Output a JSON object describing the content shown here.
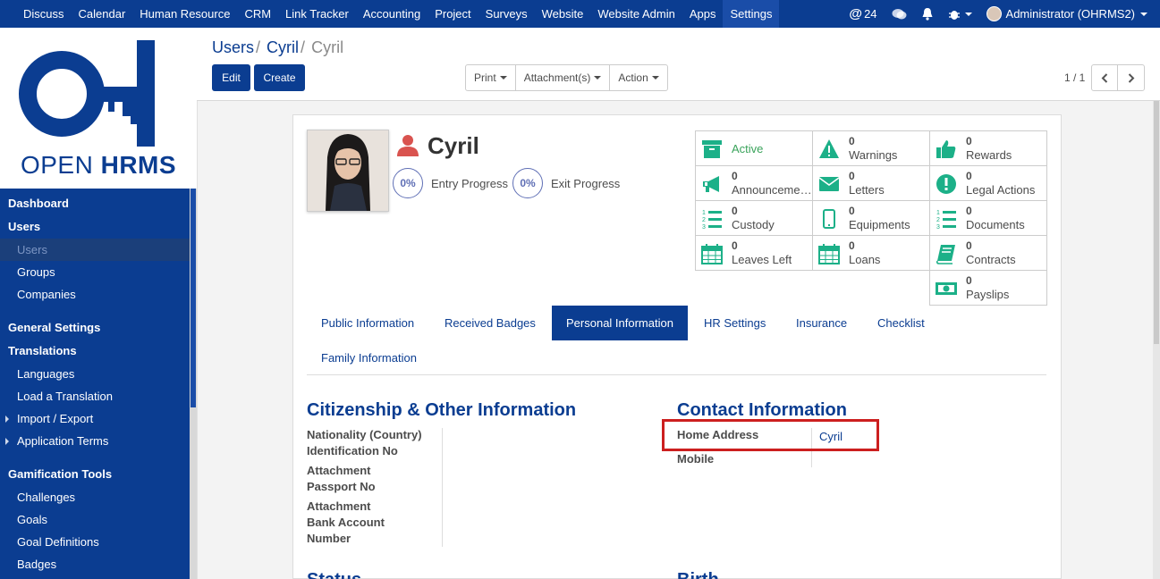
{
  "topnav": {
    "items": [
      "Discuss",
      "Calendar",
      "Human Resource",
      "CRM",
      "Link Tracker",
      "Accounting",
      "Project",
      "Surveys",
      "Website",
      "Website Admin",
      "Apps",
      "Settings"
    ],
    "active": "Settings",
    "mentions_count": "24",
    "user": "Administrator (OHRMS2)"
  },
  "logo": {
    "part1": "OPEN ",
    "part2": "HRMS"
  },
  "sidebar": {
    "dashboard": "Dashboard",
    "users_group": "Users",
    "users": "Users",
    "groups": "Groups",
    "companies": "Companies",
    "general_settings": "General Settings",
    "translations": "Translations",
    "languages": "Languages",
    "load_translation": "Load a Translation",
    "import_export": "Import / Export",
    "application_terms": "Application Terms",
    "gamification_tools": "Gamification Tools",
    "challenges": "Challenges",
    "goals": "Goals",
    "goal_definitions": "Goal Definitions",
    "badges": "Badges"
  },
  "breadcrumb": {
    "a": "Users",
    "b": "Cyril",
    "current": "Cyril"
  },
  "buttons": {
    "edit": "Edit",
    "create": "Create",
    "print": "Print",
    "attachments": "Attachment(s)",
    "action": "Action"
  },
  "pager": {
    "value": "1 / 1"
  },
  "employee": {
    "name": "Cyril",
    "entry_progress_value": "0%",
    "entry_progress_label": "Entry Progress",
    "exit_progress_value": "0%",
    "exit_progress_label": "Exit Progress"
  },
  "smart_buttons": {
    "active": "Active",
    "warnings": {
      "value": "0",
      "label": "Warnings"
    },
    "rewards": {
      "value": "0",
      "label": "Rewards"
    },
    "announcements": {
      "value": "0",
      "label": "Announcements"
    },
    "letters": {
      "value": "0",
      "label": "Letters"
    },
    "legal_actions": {
      "value": "0",
      "label": "Legal Actions"
    },
    "custody": {
      "value": "0",
      "label": "Custody"
    },
    "equipments": {
      "value": "0",
      "label": "Equipments"
    },
    "documents": {
      "value": "0",
      "label": "Documents"
    },
    "leaves_left": {
      "value": "0",
      "label": "Leaves Left"
    },
    "loans": {
      "value": "0",
      "label": "Loans"
    },
    "contracts": {
      "value": "0",
      "label": "Contracts"
    },
    "payslips": {
      "value": "0",
      "label": "Payslips"
    }
  },
  "tabs": {
    "public": "Public Information",
    "badges": "Received Badges",
    "personal": "Personal Information",
    "hr": "HR Settings",
    "insurance": "Insurance",
    "checklist": "Checklist",
    "family": "Family Information"
  },
  "citizenship": {
    "title": "Citizenship & Other Information",
    "nationality": "Nationality (Country)",
    "identification": "Identification No",
    "attachment1": "Attachment",
    "passport": "Passport No",
    "attachment2": "Attachment",
    "bank1": "Bank Account",
    "bank2": "Number"
  },
  "contact": {
    "title": "Contact Information",
    "home_address_label": "Home Address",
    "home_address_value": "Cyril",
    "mobile_label": "Mobile"
  },
  "next_sections": {
    "status": "Status",
    "birth": "Birth"
  },
  "colors": {
    "brand": "#0b3d91",
    "smart_icon": "#1cb088",
    "highlight": "#cc1f1f"
  }
}
